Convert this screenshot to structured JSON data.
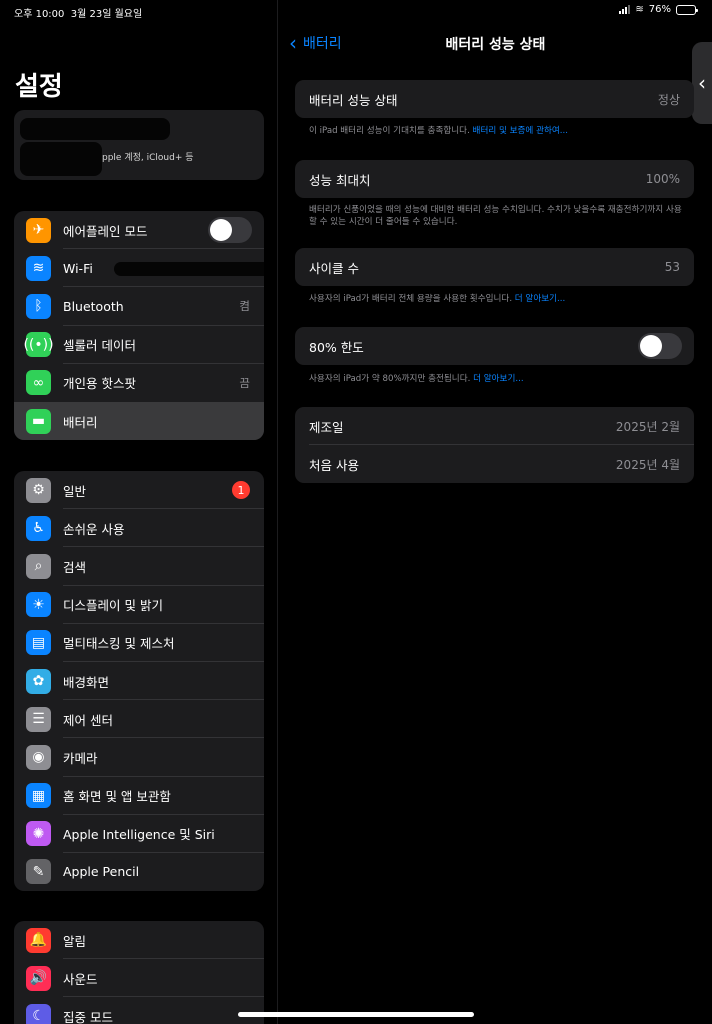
{
  "status": {
    "time": "오후 10:00",
    "date": "3월 23일 월요일",
    "battery": "76%",
    "battery_fraction": 0.76
  },
  "sidebar": {
    "title": "설정",
    "account_sub": "pple 계정, iCloud+ 등",
    "group1": [
      {
        "label": "에어플레인 모드",
        "icon": "airplane-icon",
        "color": "#ff9500",
        "glyph": "✈",
        "toggle": false
      },
      {
        "label": "Wi-Fi",
        "icon": "wifi-icon",
        "color": "#0a84ff",
        "glyph": "≋"
      },
      {
        "label": "Bluetooth",
        "icon": "bluetooth-icon",
        "color": "#0a84ff",
        "glyph": "ᛒ",
        "value": "켬"
      },
      {
        "label": "셀룰러 데이터",
        "icon": "cellular-icon",
        "color": "#30d158",
        "glyph": "((•))"
      },
      {
        "label": "개인용 핫스팟",
        "icon": "hotspot-icon",
        "color": "#30d158",
        "glyph": "∞",
        "value": "끔"
      },
      {
        "label": "배터리",
        "icon": "battery-icon",
        "color": "#30d158",
        "glyph": "▬"
      }
    ],
    "group2": [
      {
        "label": "일반",
        "icon": "gear-icon",
        "color": "#8e8e93",
        "glyph": "⚙",
        "badge": "1"
      },
      {
        "label": "손쉬운 사용",
        "icon": "accessibility-icon",
        "color": "#0a84ff",
        "glyph": "♿"
      },
      {
        "label": "검색",
        "icon": "search-icon",
        "color": "#8e8e93",
        "glyph": "⌕"
      },
      {
        "label": "디스플레이 및 밝기",
        "icon": "brightness-icon",
        "color": "#0a84ff",
        "glyph": "☀"
      },
      {
        "label": "멀티태스킹 및 제스처",
        "icon": "multitasking-icon",
        "color": "#0a84ff",
        "glyph": "▤"
      },
      {
        "label": "배경화면",
        "icon": "wallpaper-icon",
        "color": "#32ade6",
        "glyph": "✿"
      },
      {
        "label": "제어 센터",
        "icon": "control-center-icon",
        "color": "#8e8e93",
        "glyph": "☰"
      },
      {
        "label": "카메라",
        "icon": "camera-icon",
        "color": "#8e8e93",
        "glyph": "◉"
      },
      {
        "label": "홈 화면 및 앱 보관함",
        "icon": "home-screen-icon",
        "color": "#0a84ff",
        "glyph": "▦"
      },
      {
        "label": "Apple Intelligence 및 Siri",
        "icon": "siri-icon",
        "color": "#bf5af2",
        "glyph": "✺"
      },
      {
        "label": "Apple Pencil",
        "icon": "pencil-icon",
        "color": "#636366",
        "glyph": "✎"
      }
    ],
    "group3": [
      {
        "label": "알림",
        "icon": "bell-icon",
        "color": "#ff3b30",
        "glyph": "🔔"
      },
      {
        "label": "사운드",
        "icon": "speaker-icon",
        "color": "#ff2d55",
        "glyph": "🔊"
      },
      {
        "label": "집중 모드",
        "icon": "moon-icon",
        "color": "#5e5ce6",
        "glyph": "☾"
      }
    ]
  },
  "main": {
    "back_label": "배터리",
    "title": "배터리 성능 상태",
    "health": {
      "label": "배터리 성능 상태",
      "value": "정상"
    },
    "health_note": "이 iPad 배터리 성능이 기대치를 충족합니다.",
    "health_link": "배터리 및 보증에 관하여...",
    "max_capacity": {
      "label": "성능 최대치",
      "value": "100%"
    },
    "max_note": "배터리가 신품이었을 때의 성능에 대비한 배터리 성능 수치입니다. 수치가 낮을수록 재충전하기까지 사용할 수 있는 시간이 더 줄어들 수 있습니다.",
    "cycle": {
      "label": "사이클 수",
      "value": "53"
    },
    "cycle_note": "사용자의 iPad가 배터리 전체 용량을 사용한 횟수입니다.",
    "cycle_link": "더 알아보기...",
    "limit": {
      "label": "80% 한도",
      "toggle": false
    },
    "limit_note": "사용자의 iPad가 약 80%까지만 충전됩니다.",
    "limit_link": "더 알아보기...",
    "manufactured": {
      "label": "제조일",
      "value": "2025년 2월"
    },
    "first_use": {
      "label": "처음 사용",
      "value": "2025년 4월"
    }
  }
}
